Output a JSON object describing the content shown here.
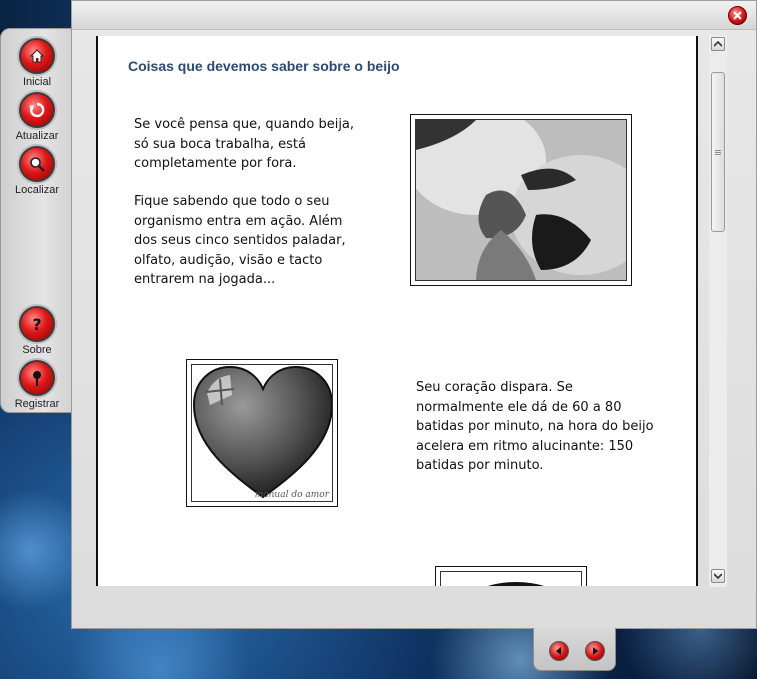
{
  "sidebar": {
    "items": [
      {
        "label": "Inicial",
        "icon": "home-icon"
      },
      {
        "label": "Atualizar",
        "icon": "refresh-icon"
      },
      {
        "label": "Localizar",
        "icon": "search-icon"
      },
      {
        "label": "Sobre",
        "icon": "help-icon"
      },
      {
        "label": "Registrar",
        "icon": "pin-icon"
      }
    ]
  },
  "window": {
    "close_icon": "close-icon"
  },
  "article": {
    "title": "Coisas que devemos saber sobre o beijo",
    "paragraph1": "Se você pensa que, quando beija, só sua boca trabalha, está completamente por fora.",
    "paragraph2": "Fique sabendo que todo o seu organismo entra em ação. Além dos seus cinco sentidos paladar, olfato, audição, visão e tacto entrarem na jogada...",
    "paragraph3": "Seu coração dispara. Se normalmente ele dá de 60 a 80 batidas por minuto, na hora do beijo acelera em ritmo alucinante: 150 batidas por minuto.",
    "heart_watermark": "manual do amor"
  },
  "bottom_nav": {
    "prev_icon": "arrow-left-icon",
    "next_icon": "arrow-right-icon"
  },
  "colors": {
    "accent_red": "#e01818",
    "heading_blue": "#2c4a72"
  }
}
